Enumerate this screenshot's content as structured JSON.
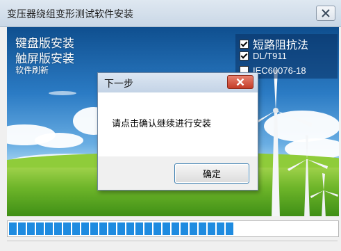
{
  "window": {
    "title": "变压器绕组变形测试软件安装",
    "close_icon": "close-icon"
  },
  "menu": {
    "items": [
      {
        "label": "键盘版安装"
      },
      {
        "label": "触屏版安装"
      },
      {
        "label": "软件刷新"
      }
    ]
  },
  "options": [
    {
      "label": "短路阻抗法",
      "checked": true
    },
    {
      "label": "DL/T911",
      "checked": true
    },
    {
      "label": "IEC60076-18",
      "checked": false
    }
  ],
  "progress": {
    "filled_blocks": 25,
    "total_blocks": 36,
    "color": "#1e8be0"
  },
  "dialog": {
    "title": "下一步",
    "message": "请点击确认继续进行安装",
    "ok_label": "确定",
    "close_icon": "close-icon"
  },
  "colors": {
    "progress": "#1e8be0",
    "dialog_close": "#c43c28"
  }
}
